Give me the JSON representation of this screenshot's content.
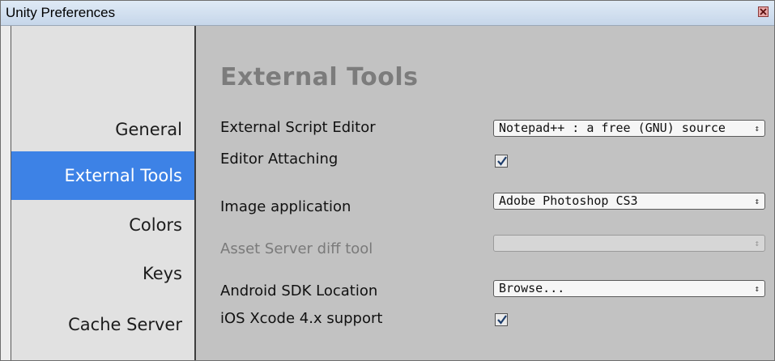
{
  "window": {
    "title": "Unity Preferences"
  },
  "sidebar": {
    "items": [
      {
        "label": "General"
      },
      {
        "label": "External Tools",
        "selected": true
      },
      {
        "label": "Colors"
      },
      {
        "label": "Keys"
      },
      {
        "label": "Cache Server"
      }
    ]
  },
  "main": {
    "heading": "External Tools",
    "script_editor": {
      "label": "External Script Editor",
      "value": "Notepad++ : a free (GNU) source"
    },
    "editor_attaching": {
      "label": "Editor Attaching",
      "checked": true
    },
    "image_application": {
      "label": "Image application",
      "value": "Adobe Photoshop CS3"
    },
    "asset_server": {
      "label": "Asset Server diff tool",
      "value": "",
      "disabled": true
    },
    "android_sdk": {
      "label": "Android SDK Location",
      "value": "Browse..."
    },
    "ios_xcode": {
      "label": "iOS Xcode 4.x support",
      "checked": true
    }
  },
  "colors": {
    "selection": "#3d82e6",
    "panel": "#c2c2c2",
    "sidebar": "#e1e1e1"
  }
}
